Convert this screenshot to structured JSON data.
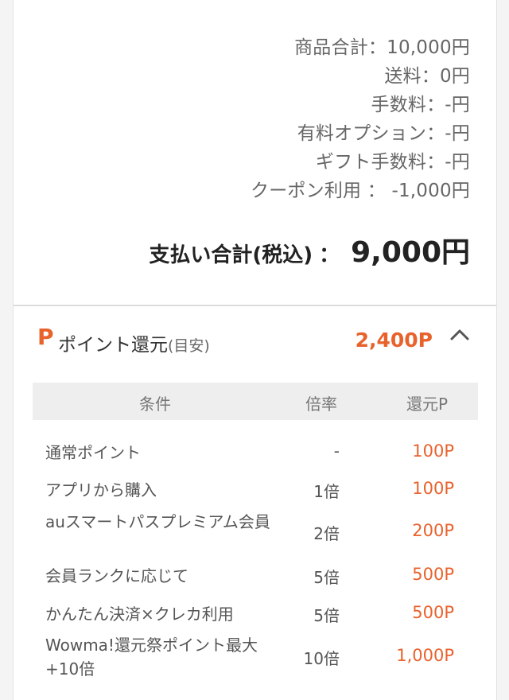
{
  "summary": {
    "lines": [
      {
        "label": "商品合計：10,000円"
      },
      {
        "label": "送料：0円"
      },
      {
        "label": "手数料：-円"
      },
      {
        "label": "有料オプション：-円"
      },
      {
        "label": "ギフト手数料：-円"
      },
      {
        "label": "クーポン利用 ： -1,000円"
      }
    ],
    "total_label": "支払い合計(税込)",
    "total_colon": "：",
    "total_value": "9,000円"
  },
  "points": {
    "icon_letter": "P",
    "title": "ポイント還元",
    "subtitle": "(目安)",
    "total": "2,400P",
    "collapse_icon": "chevron-up-icon",
    "accent_color": "#e8622c",
    "headers": {
      "condition": "条件",
      "rate": "倍率",
      "points": "還元P"
    },
    "rows": [
      {
        "condition": "通常ポイント",
        "rate": "-",
        "points": "100P"
      },
      {
        "condition": "アプリから購入",
        "rate": "1倍",
        "points": "100P"
      },
      {
        "condition": "auスマートパスプレミアム会員",
        "rate": "2倍",
        "points": "200P"
      },
      {
        "condition": "会員ランクに応じて",
        "rate": "5倍",
        "points": "500P"
      },
      {
        "condition": "かんたん決済×クレカ利用",
        "rate": "5倍",
        "points": "500P"
      },
      {
        "condition": "Wowma!還元祭ポイント最大+10倍",
        "rate": "10倍",
        "points": "1,000P"
      }
    ]
  }
}
